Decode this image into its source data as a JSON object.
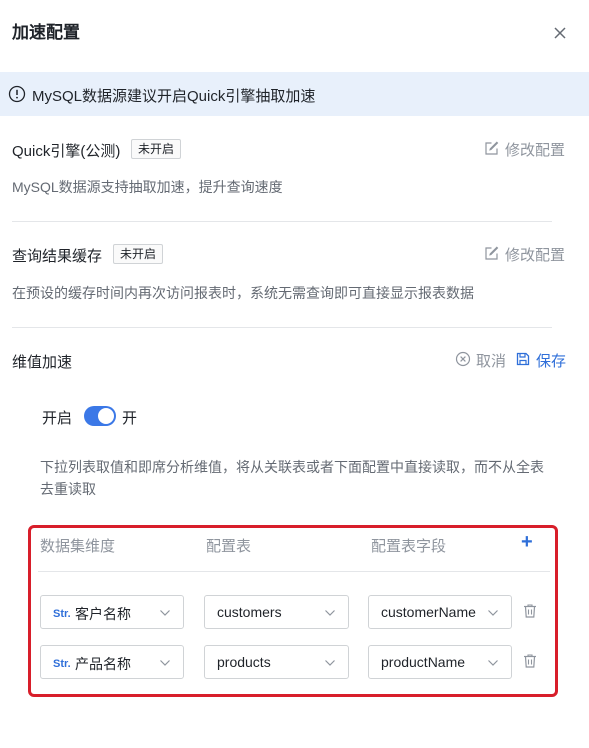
{
  "header": {
    "title": "加速配置"
  },
  "notice": {
    "text": "MySQL数据源建议开启Quick引擎抽取加速"
  },
  "quick": {
    "title": "Quick引擎(公测)",
    "badge": "未开启",
    "action": "修改配置",
    "desc": "MySQL数据源支持抽取加速，提升查询速度"
  },
  "cache": {
    "title": "查询结果缓存",
    "badge": "未开启",
    "action": "修改配置",
    "desc": "在预设的缓存时间内再次访问报表时，系统无需查询即可直接显示报表数据"
  },
  "dimension": {
    "title": "维值加速",
    "cancel": "取消",
    "save": "保存",
    "switch_label": "开启",
    "switch_state": "开",
    "switch_on": true,
    "hint": "下拉列表取值和即席分析维值，将从关联表或者下面配置中直接读取，而不从全表去重读取"
  },
  "table": {
    "columns": [
      "数据集维度",
      "配置表",
      "配置表字段"
    ],
    "add": "+",
    "rows": [
      {
        "type_tag": "Str.",
        "dimension": "客户名称",
        "table": "customers",
        "field": "customerName"
      },
      {
        "type_tag": "Str.",
        "dimension": "产品名称",
        "table": "products",
        "field": "productName"
      }
    ]
  },
  "colors": {
    "accent": "#2f6fd9",
    "highlight_border": "#d81e2a",
    "notice_bg": "#e8f0fb"
  }
}
